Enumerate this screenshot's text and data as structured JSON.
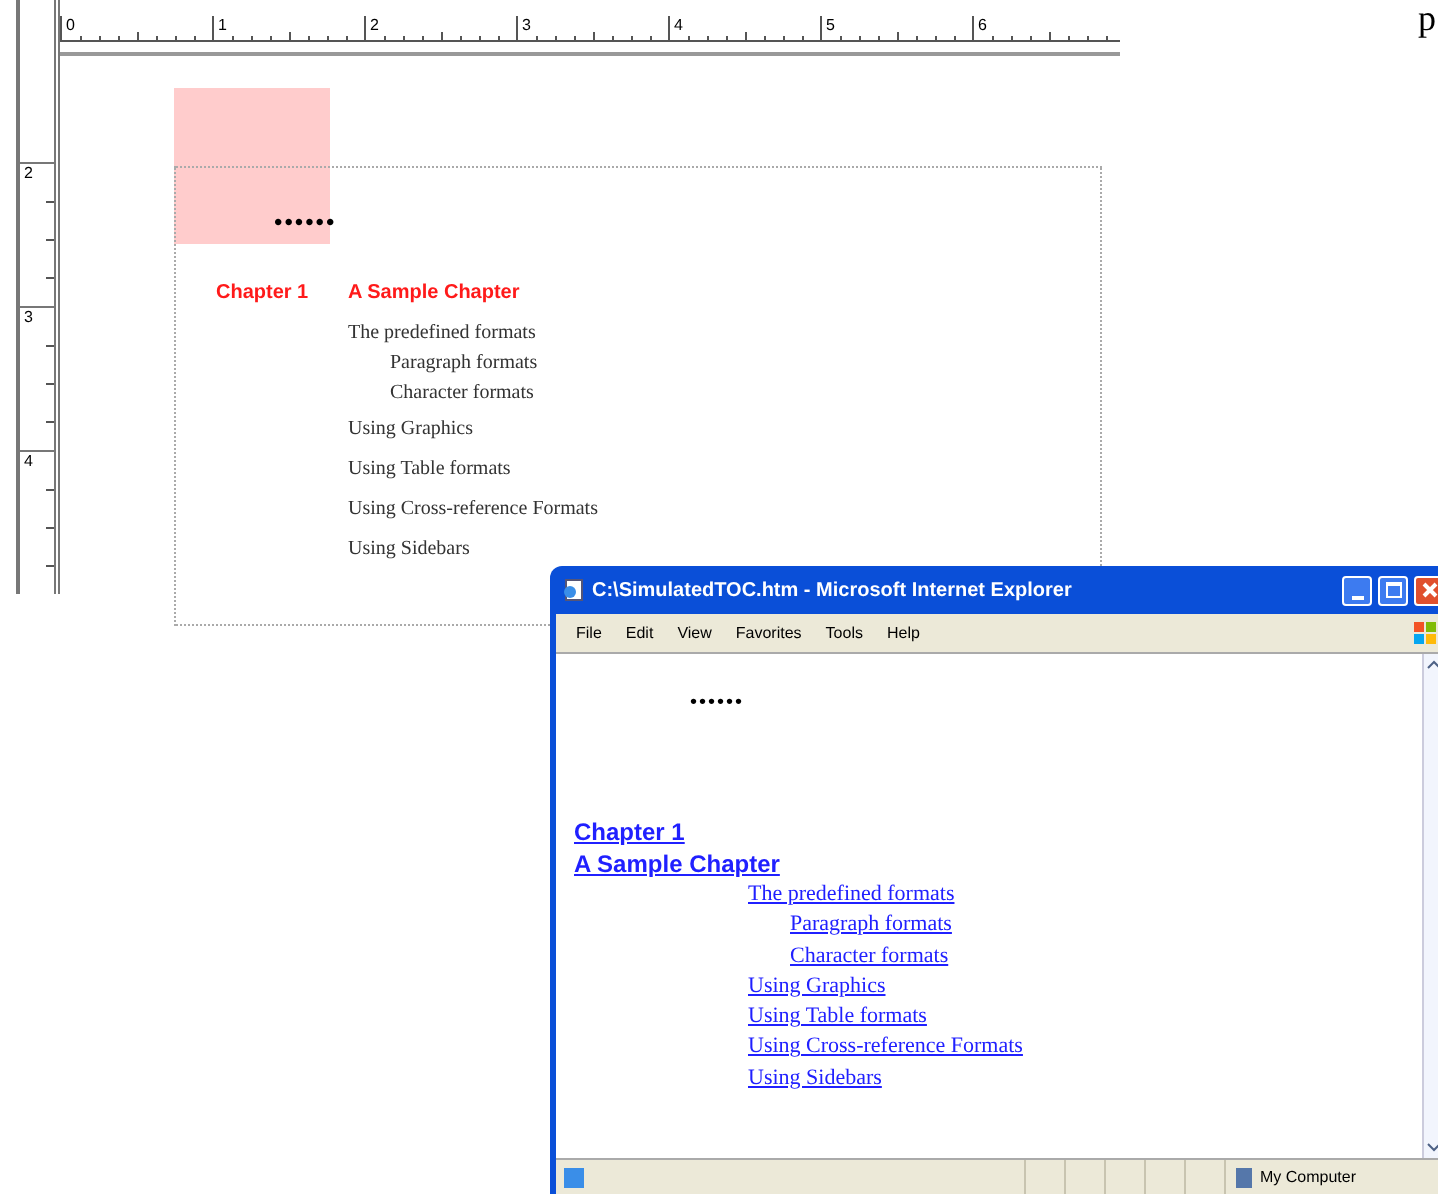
{
  "editor": {
    "ruler_marks": [
      "0",
      "1",
      "2",
      "3",
      "4",
      "5",
      "6"
    ],
    "vertical_ruler_marks": [
      "2",
      "3",
      "4"
    ],
    "page": {
      "bullets": "••••••",
      "chapter_number": "Chapter 1",
      "chapter_title": "A Sample Chapter",
      "toc": [
        {
          "text": "The predefined formats",
          "children": [
            {
              "text": "Paragraph formats"
            },
            {
              "text": "Character formats"
            }
          ]
        },
        {
          "text": "Using Graphics"
        },
        {
          "text": "Using Table formats"
        },
        {
          "text": "Using Cross-reference Formats"
        },
        {
          "text": "Using Sidebars"
        }
      ]
    }
  },
  "stray_text": "p",
  "browser": {
    "title": "C:\\SimulatedTOC.htm - Microsoft Internet Explorer",
    "menu": [
      "File",
      "Edit",
      "View",
      "Favorites",
      "Tools",
      "Help"
    ],
    "page": {
      "bullets": "••••••",
      "chapter_number": "Chapter 1",
      "chapter_title": "A Sample Chapter",
      "toc": [
        {
          "text": "The predefined formats",
          "children": [
            {
              "text": "Paragraph formats"
            },
            {
              "text": "Character formats"
            }
          ]
        },
        {
          "text": "Using Graphics"
        },
        {
          "text": "Using Table formats"
        },
        {
          "text": "Using Cross-reference Formats"
        },
        {
          "text": "Using Sidebars"
        }
      ]
    },
    "status_bar": {
      "zone": "My Computer"
    }
  }
}
